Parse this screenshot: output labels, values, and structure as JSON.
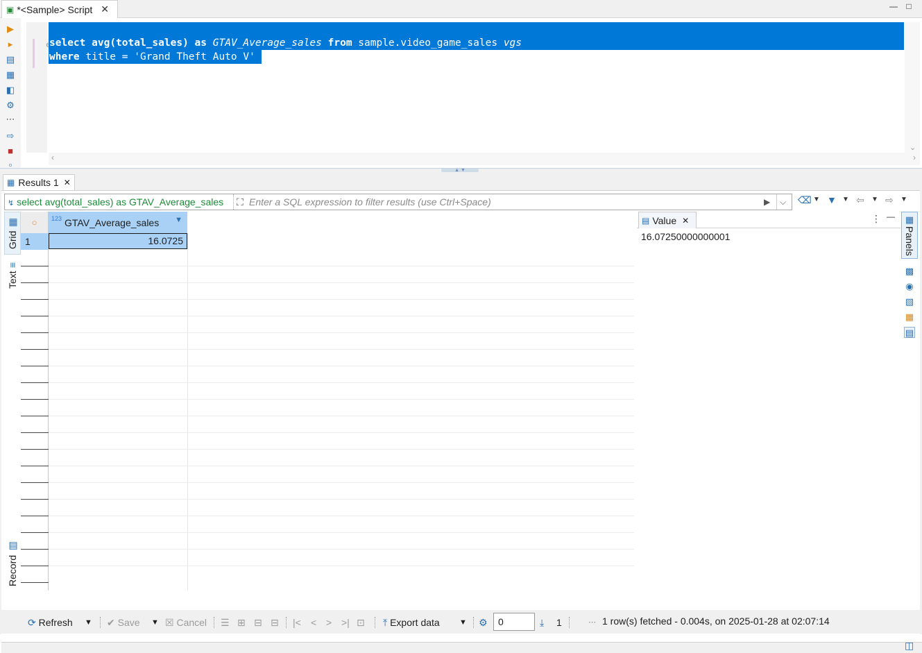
{
  "editor_tab": {
    "title": "*<Sample> Script"
  },
  "editor": {
    "line1": {
      "kw_select": "select",
      "fn": "avg(total_sales)",
      "kw_as": "as",
      "alias": "GTAV_Average_sales",
      "kw_from": "from",
      "table": "sample.video_game_sales",
      "table_alias": "vgs"
    },
    "line2": {
      "kw_where": "where",
      "rest": "title = 'Grand Theft Auto V'"
    }
  },
  "results_tab": {
    "title": "Results 1"
  },
  "filter": {
    "query_text": "select avg(total_sales) as GTAV_Average_sales",
    "placeholder": "Enter a SQL expression to filter results (use Ctrl+Space)"
  },
  "view_tabs": {
    "grid": "Grid",
    "text": "Text",
    "record": "Record"
  },
  "grid": {
    "columns": [
      {
        "type_badge": "123",
        "name": "GTAV_Average_sales"
      }
    ],
    "rows": [
      {
        "num": "1",
        "values": [
          "16.0725"
        ]
      }
    ]
  },
  "value_panel": {
    "tab_title": "Value",
    "value": "16.07250000000001"
  },
  "panels_tab": {
    "label": "Panels"
  },
  "bottom_toolbar": {
    "refresh": "Refresh",
    "save": "Save",
    "cancel": "Cancel",
    "export": "Export data",
    "page_value": "0",
    "page_count": "1",
    "status": "1 row(s) fetched - 0.004s, on 2025-01-28 at 02:07:14"
  },
  "colors": {
    "selection": "#0078d7",
    "header_selected": "#a8d1f5",
    "accent": "#2a6fb0",
    "filter_query": "#1d8a3b"
  }
}
